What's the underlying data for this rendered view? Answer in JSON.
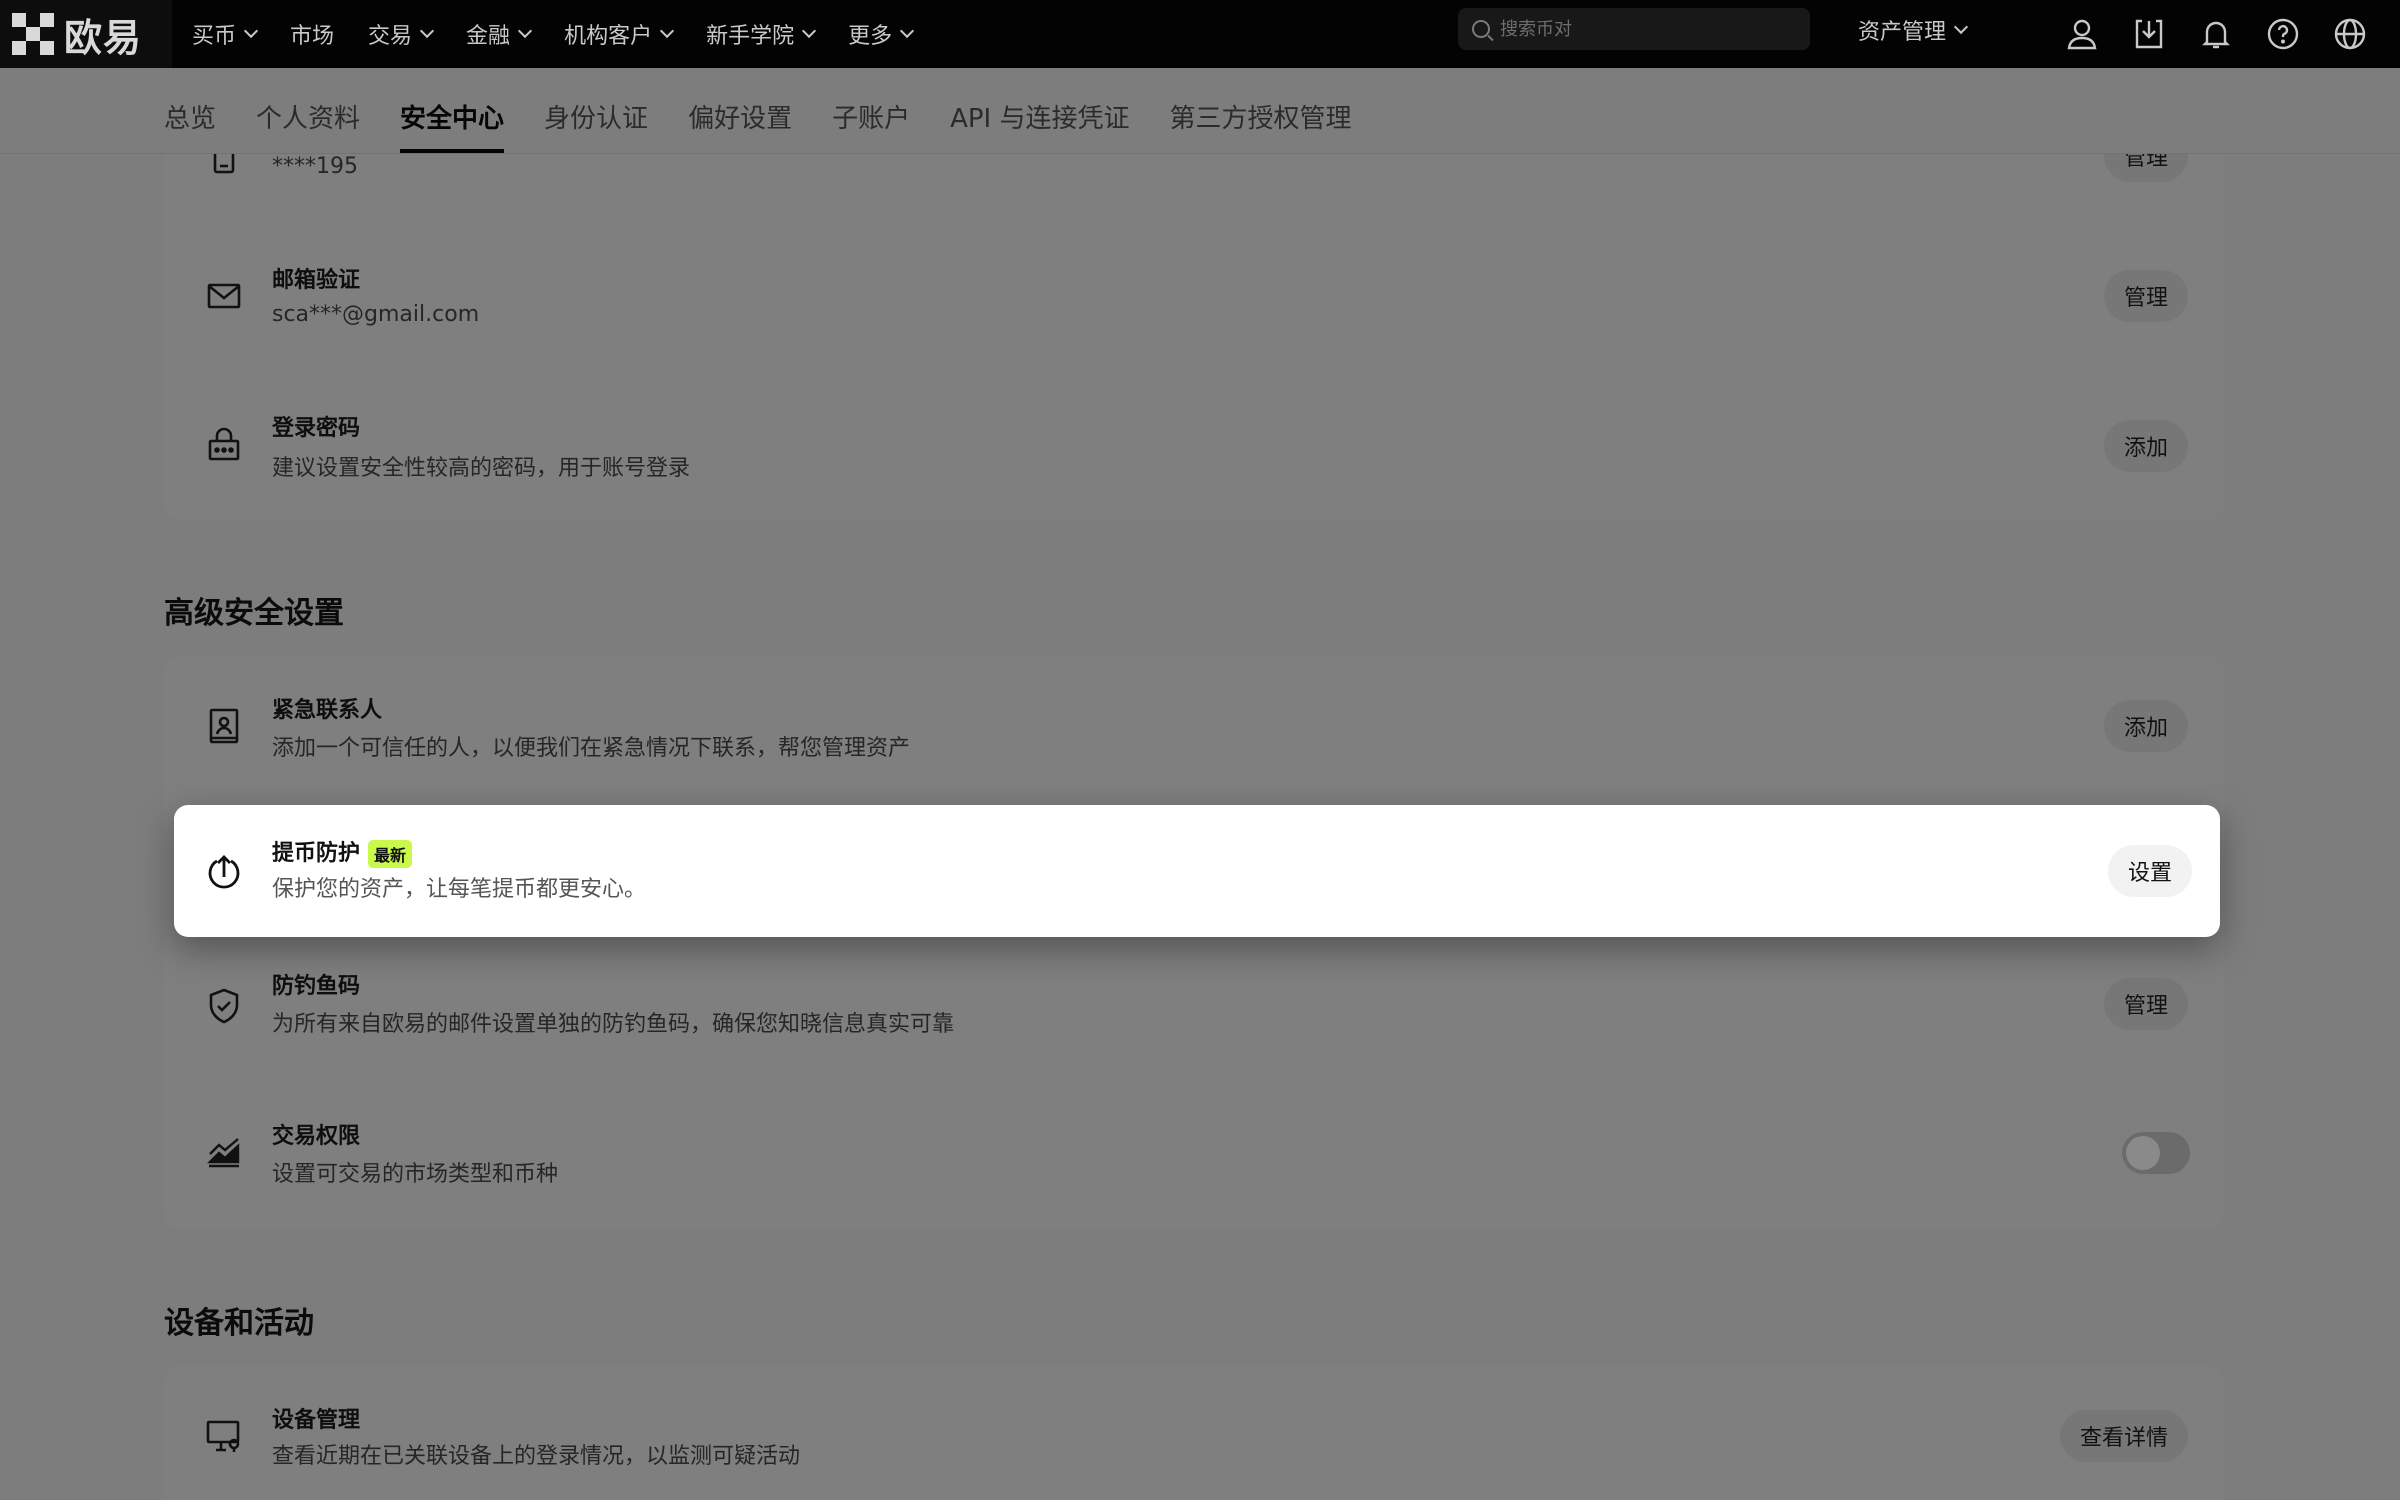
{
  "brand": {
    "name": "欧易"
  },
  "topnav": {
    "items": [
      {
        "label": "买币",
        "has_menu": true
      },
      {
        "label": "市场",
        "has_menu": false
      },
      {
        "label": "交易",
        "has_menu": true
      },
      {
        "label": "金融",
        "has_menu": true
      },
      {
        "label": "机构客户",
        "has_menu": true
      },
      {
        "label": "新手学院",
        "has_menu": true
      },
      {
        "label": "更多",
        "has_menu": true
      }
    ],
    "search_placeholder": "搜索币对",
    "asset_management": "资产管理",
    "icons": [
      "user-icon",
      "download-icon",
      "bell-icon",
      "help-icon",
      "globe-icon"
    ]
  },
  "tabs": [
    {
      "label": "总览",
      "active": false
    },
    {
      "label": "个人资料",
      "active": false
    },
    {
      "label": "安全中心",
      "active": true
    },
    {
      "label": "身份认证",
      "active": false
    },
    {
      "label": "偏好设置",
      "active": false
    },
    {
      "label": "子账户",
      "active": false
    },
    {
      "label": "API 与连接凭证",
      "active": false
    },
    {
      "label": "第三方授权管理",
      "active": false
    }
  ],
  "basic_security": {
    "phone": {
      "value": "****195",
      "button": "管理"
    },
    "email": {
      "title": "邮箱验证",
      "value": "sca***@gmail.com",
      "button": "管理"
    },
    "password": {
      "title": "登录密码",
      "desc": "建议设置安全性较高的密码，用于账号登录",
      "button": "添加"
    }
  },
  "advanced_security": {
    "title": "高级安全设置",
    "emergency": {
      "title": "紧急联系人",
      "desc": "添加一个可信任的人，以便我们在紧急情况下联系，帮您管理资产",
      "button": "添加"
    },
    "withdraw_protect": {
      "title": "提币防护",
      "badge": "最新",
      "desc": "保护您的资产，让每笔提币都更安心。",
      "button": "设置"
    },
    "anti_phishing": {
      "title": "防钓鱼码",
      "desc": "为所有来自欧易的邮件设置单独的防钓鱼码，确保您知晓信息真实可靠",
      "button": "管理"
    },
    "trade_permission": {
      "title": "交易权限",
      "desc": "设置可交易的市场类型和币种",
      "toggle_on": false
    }
  },
  "devices": {
    "title": "设备和活动",
    "device_mgmt": {
      "title": "设备管理",
      "desc": "查看近期在已关联设备上的登录情况，以监测可疑活动",
      "button": "查看详情"
    }
  }
}
